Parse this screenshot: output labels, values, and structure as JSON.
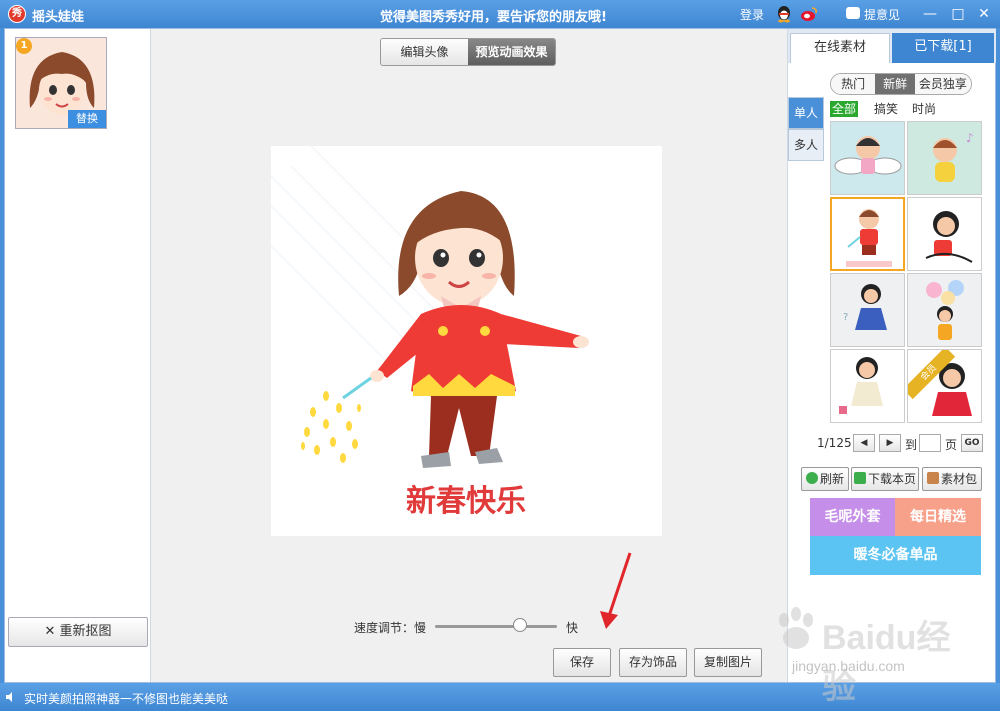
{
  "window": {
    "logo_text": "秀",
    "title": "摇头娃娃",
    "slogan": "觉得美图秀秀好用，要告诉您的朋友哦!",
    "login": "登录",
    "feedback": "提意见",
    "minimize": "—",
    "maximize": "□",
    "close": "✕"
  },
  "left": {
    "thumb_number": "1",
    "replace_label": "替换",
    "recut_label": "重新抠图"
  },
  "center": {
    "tabs": [
      {
        "label": "编辑头像",
        "active": false
      },
      {
        "label": "预览动画效果",
        "active": true
      }
    ],
    "preview_caption": "新春快乐",
    "speed_label": "速度调节：慢",
    "speed_fast": "快",
    "speed_value_percent": 70,
    "buttons": {
      "save": "保存",
      "save_as_ornament": "存为饰品",
      "copy_image": "复制图片"
    }
  },
  "right": {
    "tabs": [
      {
        "label": "在线素材",
        "active": true
      },
      {
        "label": "已下载[1]",
        "active": false
      }
    ],
    "sub_tabs": [
      {
        "label": "热门",
        "active": false
      },
      {
        "label": "新鲜",
        "active": true
      },
      {
        "label": "会员独享",
        "active": false
      }
    ],
    "side_tabs": [
      {
        "label": "单人",
        "active": true
      },
      {
        "label": "多人",
        "active": false
      }
    ],
    "filters": [
      {
        "label": "全部",
        "active": true
      },
      {
        "label": "搞笑",
        "active": false
      },
      {
        "label": "时尚",
        "active": false
      }
    ],
    "vip_badge": "会员",
    "pager": {
      "current": "1/125",
      "goto_label": "到",
      "page_suffix": "页",
      "go": "GO",
      "prev": "◀",
      "next": "▶"
    },
    "tools": {
      "refresh": "刷新",
      "download_page": "下载本页",
      "material_pack": "素材包"
    },
    "banners": {
      "a": "毛呢外套",
      "b": "每日精选",
      "c": "暖冬必备单品"
    }
  },
  "status": {
    "text": "实时美颜拍照神器一不修图也能美美哒"
  },
  "watermark": {
    "brand": "Baidu经验",
    "url": "jingyan.baidu.com"
  },
  "colors": {
    "titlebar": "#3f86d2",
    "accent_orange": "#f5a623",
    "filter_green": "#2aa830"
  }
}
